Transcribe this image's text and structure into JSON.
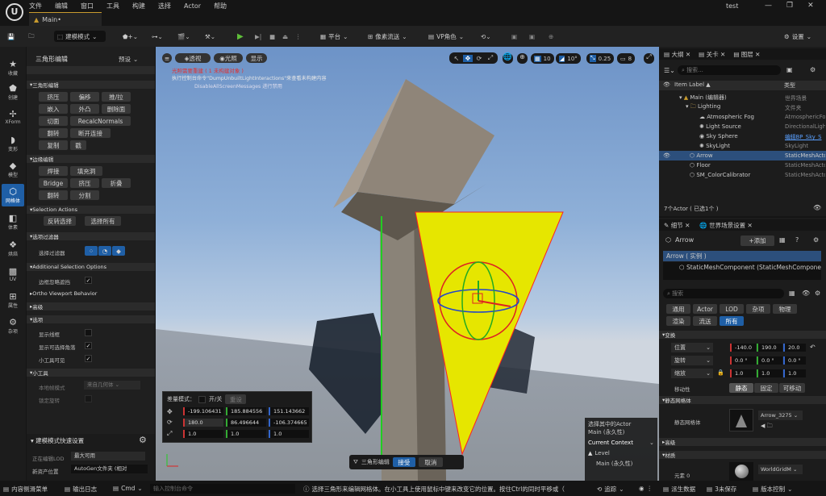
{
  "titlebar": {
    "menus": [
      "文件",
      "编辑",
      "窗口",
      "工具",
      "构建",
      "选择",
      "Actor",
      "帮助"
    ],
    "tab": "Main•",
    "title": "test"
  },
  "toolbar": {
    "mode": "建模模式",
    "platform": "平台",
    "pixel": "像素流送",
    "vp": "VP角色",
    "settings": "设置"
  },
  "leftcol": [
    "收藏",
    "创建",
    "XForm",
    "变形",
    "模型",
    "网格体",
    "体素",
    "烘焙",
    "UV",
    "属性",
    "杂项"
  ],
  "tool": {
    "title": "三角形编辑",
    "preset": "预设",
    "sec_tri": "三角形编辑",
    "tri_buttons": [
      "挤压",
      "偏移",
      "推/拉",
      "嵌入",
      "外凸",
      "删除面",
      "切面",
      "RecalcNormals",
      "翻转",
      "断开连接",
      "复制",
      "戳"
    ],
    "sec_edge": "边缘编辑",
    "edge_buttons": [
      "焊接",
      "填充洞",
      "Bridge",
      "挤压",
      "折叠",
      "翻转",
      "分割"
    ],
    "sec_sel": "Selection Actions",
    "sel_buttons": [
      "反转选择",
      "选择所有"
    ],
    "sec_filter": "选项过滤器",
    "filter_label": "选择过滤器",
    "sec_addsel": "Additional Selection Options",
    "boundary": "边框忽略遮挡",
    "ortho": "Ortho Viewport Behavior",
    "sec_adv": "高级",
    "sec_opt": "选项",
    "show_wire": "显示线框",
    "show_sel_corner": "显示可选择角落",
    "gizmo_visible": "小工具可见",
    "sec_gizmo": "小工具",
    "local_frame": "本地帧模式",
    "local_frame_val": "来自几何体",
    "lock_rot": "锁定旋转",
    "quick": "建模模式快速设置",
    "lod_label": "正在编辑LOD",
    "lod_val": "最大可用",
    "asset_label": "新资产位置",
    "asset_val": "AutoGen文件夹 (相对"
  },
  "viewport": {
    "btn_persp": "透视",
    "btn_lit": "光照",
    "btn_show": "显示",
    "warn1": "光照需要重建 ( 1 未构建对象 )",
    "warn2": "执行控制台命令\"DumpUnbuiltLightInteractions\"来查看未构建内容",
    "warn3": "DisableAllScreenMessages 进行禁用",
    "grid": "10",
    "angle": "10°",
    "scale": "0.25",
    "cam": "8",
    "delta_label": "差量模式：",
    "onoff": "开/关",
    "reset": "重设",
    "loc": [
      "-199.106431",
      "185.884556",
      "151.143662"
    ],
    "rot": [
      "180.0",
      "86.496644",
      "-106.374665"
    ],
    "scl": [
      "1.0",
      "1.0",
      "1.0"
    ],
    "accept_tool": "三角形编辑",
    "accept": "接受",
    "cancel": "取消",
    "ctx1": "选择其中的Actor",
    "ctx2": "Main (永久性)",
    "ctx_title": "Current Context",
    "ctx_level": "Level",
    "ctx_level_val": "Main (永久性)"
  },
  "outliner": {
    "tabs": [
      "大纲",
      "关卡",
      "图层"
    ],
    "search": "搜索...",
    "col_label": "Item Label ▲",
    "col_type": "类型",
    "rows": [
      {
        "name": "Main (编辑器)",
        "type": "世界场景"
      },
      {
        "name": "Lighting",
        "type": "文件夹"
      },
      {
        "name": "Atmospheric Fog",
        "type": "AtmosphericFog"
      },
      {
        "name": "Light Source",
        "type": "DirectionalLight"
      },
      {
        "name": "Sky Sphere",
        "type": "编辑BP_Sky_S"
      },
      {
        "name": "SkyLight",
        "type": "SkyLight"
      },
      {
        "name": "Arrow",
        "type": "StaticMeshActor"
      },
      {
        "name": "Floor",
        "type": "StaticMeshActor"
      },
      {
        "name": "SM_ColorCalibrator",
        "type": "StaticMeshActor"
      }
    ],
    "count": "7个Actor ( 已选1个 )"
  },
  "details": {
    "tabs": [
      "细节",
      "世界场景设置"
    ],
    "actor": "Arrow",
    "add": "+添加",
    "instance": "Arrow ( 实例 )",
    "component": "StaticMeshComponent (StaticMeshComponent",
    "search": "搜索",
    "cats1": [
      "通用",
      "Actor",
      "LOD",
      "杂项",
      "物理"
    ],
    "cats2": [
      "渲染",
      "流送",
      "所有"
    ],
    "sec_transform": "变换",
    "loc_label": "位置",
    "loc": [
      "-140.0",
      "190.0",
      "20.0"
    ],
    "rot_label": "旋转",
    "rot": [
      "0.0 °",
      "0.0 °",
      "0.0 °"
    ],
    "scl_label": "缩放",
    "scl": [
      "1.0",
      "1.0",
      "1.0"
    ],
    "mob_label": "移动性",
    "mob": [
      "静态",
      "固定",
      "可移动"
    ],
    "sec_mesh": "静态网格体",
    "mesh_label": "静态网格体",
    "mesh_val": "Arrow_3275",
    "sec_adv": "高级",
    "sec_mat": "材质",
    "mat_label": "元素 0",
    "mat_val": "WorldGridM"
  },
  "statusbar": {
    "drawer": "内容侧滑菜单",
    "log": "输出日志",
    "cmd": "Cmd",
    "cmd_ph": "输入控制台命令",
    "hint": "选择三角形来编辑网格体。在小工具上使用鼠标中键来改变它的位置。按住Ctrl的同时平移或（",
    "trace": "追踪",
    "derived": "派生数据",
    "unsaved": "3未保存",
    "vc": "版本控制"
  }
}
